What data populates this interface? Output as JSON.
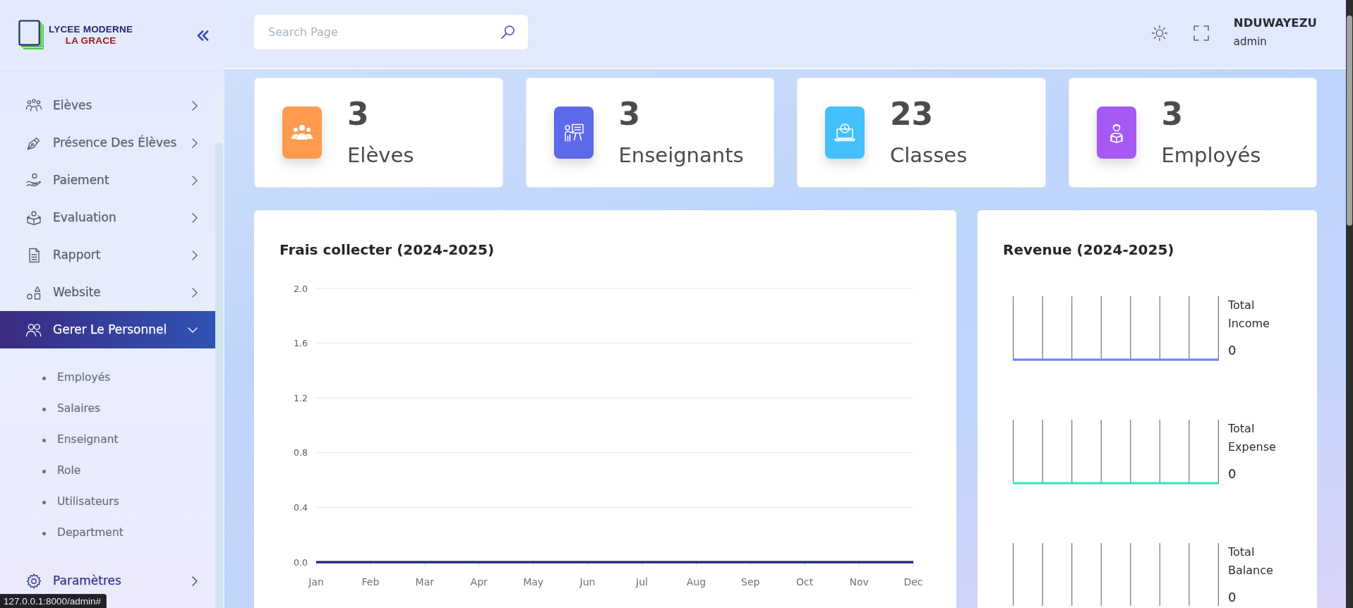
{
  "sidebar": {
    "logo": {
      "line_1": "LYCEE MODERNE",
      "line_2": "LA GRACE"
    },
    "menu": [
      {
        "label": "Elèves",
        "selected": false,
        "expanded": false,
        "hovered": false
      },
      {
        "label": "Présence Des Élèves",
        "selected": false,
        "expanded": false,
        "hovered": false
      },
      {
        "label": "Paiement",
        "selected": false,
        "expanded": false,
        "hovered": false
      },
      {
        "label": "Evaluation",
        "selected": false,
        "expanded": false,
        "hovered": false
      },
      {
        "label": "Rapport",
        "selected": false,
        "expanded": false,
        "hovered": false
      },
      {
        "label": "Website",
        "selected": false,
        "expanded": false,
        "hovered": false
      },
      {
        "label": "Gerer Le Personnel",
        "selected": true,
        "expanded": true,
        "hovered": false,
        "children": [
          {
            "label": "Employés"
          },
          {
            "label": "Salaires"
          },
          {
            "label": "Enseignant"
          },
          {
            "label": "Role"
          },
          {
            "label": "Utilisateurs"
          },
          {
            "label": "Department"
          }
        ]
      },
      {
        "label": "Paramètres",
        "selected": false,
        "expanded": false,
        "hovered": true
      }
    ]
  },
  "header": {
    "search": {
      "placeholder": "Search Page"
    },
    "user": {
      "name": "NDUWAYEZU",
      "role": "admin"
    }
  },
  "stats": [
    {
      "value": "3",
      "label": "Elèves",
      "color": "#ff9a4f"
    },
    {
      "value": "3",
      "label": "Enseignants",
      "color": "#5d69e8"
    },
    {
      "value": "23",
      "label": "Classes",
      "color": "#45c0fa"
    },
    {
      "value": "3",
      "label": "Employés",
      "color": "#a65af3"
    }
  ],
  "fees_chart": {
    "title": "Frais collecter (2024-2025)",
    "chart_data": {
      "type": "line",
      "categories": [
        "Jan",
        "Feb",
        "Mar",
        "Apr",
        "May",
        "Jun",
        "Jul",
        "Aug",
        "Sep",
        "Oct",
        "Nov",
        "Dec"
      ],
      "series": [
        {
          "color": "#2b2a7c",
          "values": [
            0,
            0,
            0,
            0,
            0,
            0,
            0,
            0,
            0,
            0,
            0,
            0
          ]
        }
      ],
      "ylim": [
        0,
        2
      ],
      "yticks": [
        {
          "value": 0,
          "label": "0.0"
        },
        {
          "value": 0.4,
          "label": "0.4"
        },
        {
          "value": 0.8,
          "label": "0.8"
        },
        {
          "value": 1.2,
          "label": "1.2"
        },
        {
          "value": 1.6,
          "label": "1.6"
        },
        {
          "value": 2,
          "label": "2.0"
        }
      ],
      "grid": true
    }
  },
  "revenue": {
    "title": "Revenue (2024-2025)",
    "items": [
      {
        "label": "Total Income",
        "value": "0",
        "color": "#6c7ef6"
      },
      {
        "label": "Total Expense",
        "value": "0",
        "color": "#2ee6b8"
      },
      {
        "label": "Total Balance",
        "value": "0"
      }
    ]
  },
  "browser_status": {
    "url": "127.0.0.1:8000/admin#"
  }
}
